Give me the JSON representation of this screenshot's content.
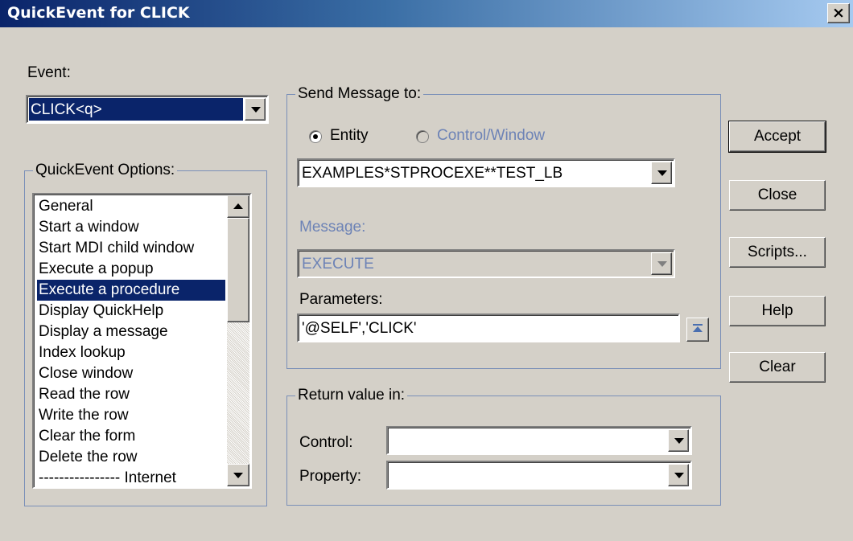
{
  "window": {
    "title": "QuickEvent for CLICK",
    "close_glyph": "×"
  },
  "event": {
    "label": "Event:",
    "value": "CLICK<q>"
  },
  "options": {
    "title": "QuickEvent Options:",
    "items": [
      "General",
      "Start a window",
      "Start MDI child window",
      "Execute a popup",
      "Execute a procedure",
      "Display QuickHelp",
      "Display a message",
      "Index lookup",
      "Close window",
      "Read the row",
      "Write the row",
      "Clear the form",
      "Delete the row",
      "---------------- Internet"
    ],
    "selected_index": 4
  },
  "send": {
    "title": "Send Message to:",
    "radio_entity": "Entity",
    "radio_control": "Control/Window",
    "entity_value": "EXAMPLES*STPROCEXE**TEST_LB",
    "message_label": "Message:",
    "message_value": "EXECUTE",
    "parameters_label": "Parameters:",
    "parameters_value": "'@SELF','CLICK'"
  },
  "return": {
    "title": "Return value in:",
    "control_label": "Control:",
    "control_value": "",
    "property_label": "Property:",
    "property_value": ""
  },
  "buttons": {
    "accept": "Accept",
    "close": "Close",
    "scripts": "Scripts...",
    "help": "Help",
    "clear": "Clear"
  }
}
